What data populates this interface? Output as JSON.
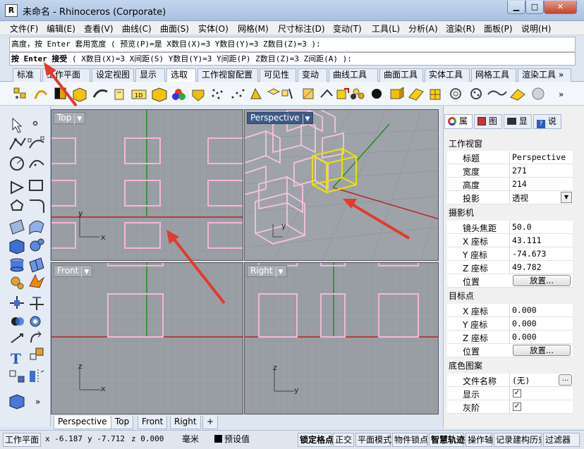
{
  "window": {
    "title": "未命名 - Rhinoceros (Corporate)",
    "min": "▁",
    "max": "□",
    "close": "✕",
    "app_icon": "R"
  },
  "menu": [
    "文件(F)",
    "编辑(E)",
    "查看(V)",
    "曲线(C)",
    "曲面(S)",
    "实体(O)",
    "网格(M)",
    "尺寸标注(D)",
    "变动(T)",
    "工具(L)",
    "分析(A)",
    "渲染(R)",
    "面板(P)",
    "说明(H)"
  ],
  "command": {
    "history": "高度，按 Enter 套用宽度 ( 预览(P)=是  X数目(X)=3  Y数目(Y)=3  Z数目(Z)=3 ):",
    "prompt_bold": "按 Enter 接受",
    "prompt_rest": " ( X数目(X)=3  X间距(S)  Y数目(Y)=3  Y间距(P)  Z数目(Z)=3  Z间距(A) ):"
  },
  "toolbar_tabs": [
    "标准",
    "工作平面",
    "设定视图",
    "显示",
    "选取",
    "工作视窗配置",
    "可见性",
    "变动",
    "曲线工具",
    "曲面工具",
    "实体工具",
    "网格工具",
    "渲染工具 »"
  ],
  "toolbar_tabs_active": "选取",
  "viewports": {
    "top": {
      "label": "Top",
      "axis_x": "x",
      "axis_y": "y"
    },
    "perspective": {
      "label": "Perspective",
      "axis_y": "y"
    },
    "front": {
      "label": "Front",
      "axis_x": "x",
      "axis_y": "z"
    },
    "right": {
      "label": "Right",
      "axis_x": "y",
      "axis_y": "z"
    }
  },
  "viewport_tabs": [
    "Perspective",
    "Top",
    "Front",
    "Right",
    "+"
  ],
  "panel": {
    "tabs": [
      "属",
      "图",
      "显",
      "说"
    ],
    "viewport_section": "工作视窗",
    "viewport_rows": [
      {
        "label": "标题",
        "value": "Perspective"
      },
      {
        "label": "宽度",
        "value": "271"
      },
      {
        "label": "高度",
        "value": "214"
      },
      {
        "label": "投影",
        "value": "透视"
      }
    ],
    "camera_section": "摄影机",
    "camera_rows": [
      {
        "label": "镜头焦距",
        "value": "50.0"
      },
      {
        "label": "X 座标",
        "value": "43.111"
      },
      {
        "label": "Y 座标",
        "value": "-74.673"
      },
      {
        "label": "Z 座标",
        "value": "49.782"
      }
    ],
    "camera_position_label": "位置",
    "camera_position_button": "放置...",
    "target_section": "目标点",
    "target_rows": [
      {
        "label": "X 座标",
        "value": "0.000"
      },
      {
        "label": "Y 座标",
        "value": "0.000"
      },
      {
        "label": "Z 座标",
        "value": "0.000"
      }
    ],
    "target_position_label": "位置",
    "target_position_button": "放置...",
    "wallpaper_section": "底色图案",
    "file_label": "文件名称",
    "file_value": "(无)",
    "file_button": "...",
    "show_label": "显示",
    "gray_label": "灰阶",
    "check": "✓"
  },
  "status": {
    "cplane": "工作平面",
    "x": "x -6.187",
    "y": "y -7.712",
    "z": "z 0.000",
    "units": "毫米",
    "layer": "预设值",
    "items": [
      "锁定格点",
      "正交",
      "平面模式",
      "物件锁点",
      "智慧轨迹",
      "操作轴",
      "记录建构历史",
      "过滤器"
    ]
  },
  "colors": {
    "accent": "#3d5a86",
    "arrow": "#e23b2e",
    "box_pink": "#f3b7d7",
    "selected": "#e6e600"
  }
}
